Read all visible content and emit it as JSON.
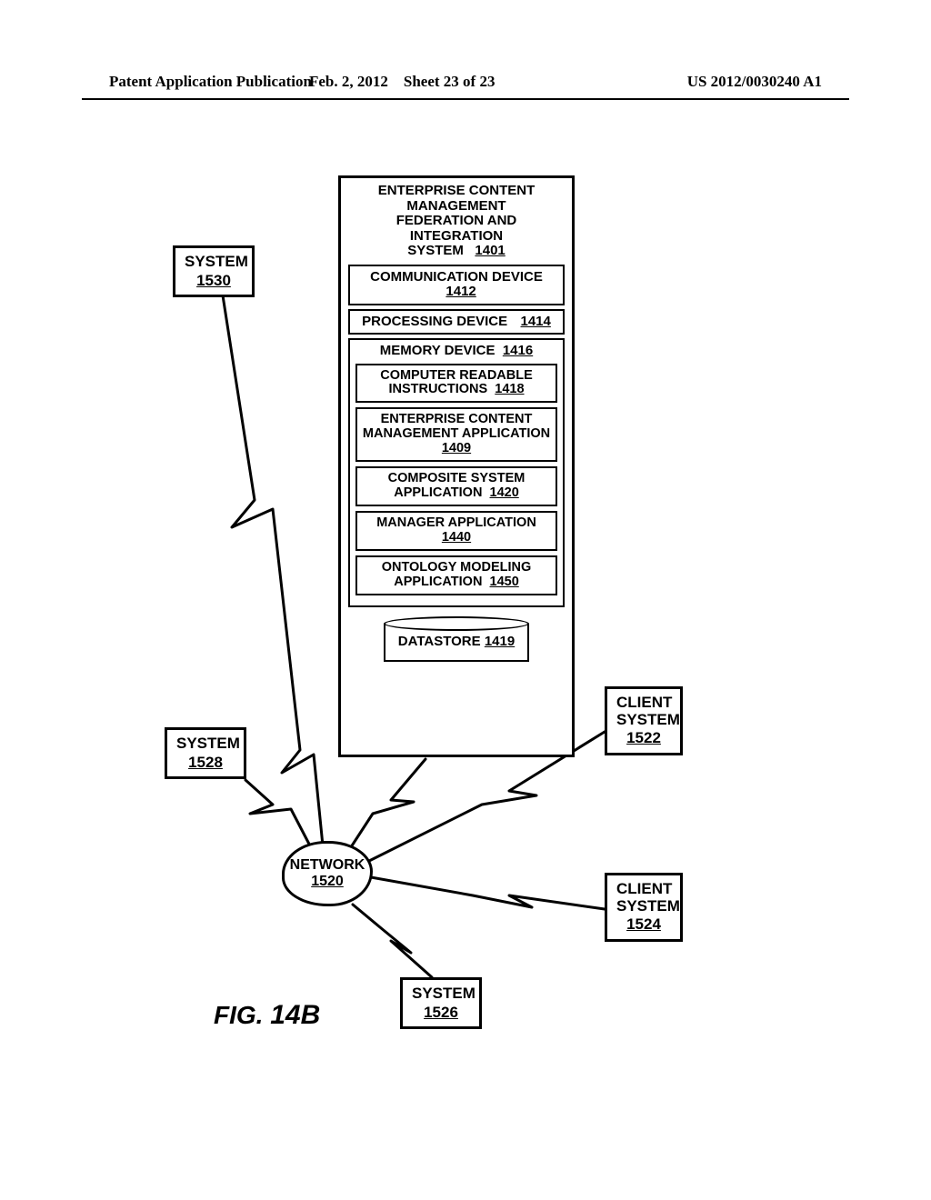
{
  "header": {
    "left": "Patent Application Publication",
    "mid_date": "Feb. 2, 2012",
    "mid_sheet": "Sheet 23 of 23",
    "right": "US 2012/0030240 A1"
  },
  "ecm": {
    "title_l1": "ENTERPRISE CONTENT MANAGEMENT",
    "title_l2": "FEDERATION AND INTEGRATION",
    "title_l3": "SYSTEM",
    "ref": "1401",
    "comm": {
      "label": "COMMUNICATION DEVICE",
      "ref": "1412"
    },
    "proc": {
      "label": "PROCESSING DEVICE",
      "ref": "1414"
    },
    "mem": {
      "label": "MEMORY DEVICE",
      "ref": "1416"
    },
    "cri": {
      "label_l1": "COMPUTER READABLE",
      "label_l2": "INSTRUCTIONS",
      "ref": "1418"
    },
    "app": {
      "label_l1": "ENTERPRISE CONTENT",
      "label_l2": "MANAGEMENT APPLICATION",
      "ref": "1409"
    },
    "comp": {
      "label_l1": "COMPOSITE SYSTEM",
      "label_l2": "APPLICATION",
      "ref": "1420"
    },
    "mgr": {
      "label_l1": "MANAGER APPLICATION",
      "ref": "1440"
    },
    "ont": {
      "label_l1": "ONTOLOGY MODELING",
      "label_l2": "APPLICATION",
      "ref": "1450"
    },
    "ds": {
      "label": "DATASTORE",
      "ref": "1419"
    }
  },
  "nodes": {
    "sys1530": {
      "label": "SYSTEM",
      "ref": "1530"
    },
    "sys1528": {
      "label": "SYSTEM",
      "ref": "1528"
    },
    "sys1526": {
      "label": "SYSTEM",
      "ref": "1526"
    },
    "client1522": {
      "label_l1": "CLIENT",
      "label_l2": "SYSTEM",
      "ref": "1522"
    },
    "client1524": {
      "label_l1": "CLIENT",
      "label_l2": "SYSTEM",
      "ref": "1524"
    },
    "network": {
      "label": "NETWORK",
      "ref": "1520"
    }
  },
  "figure": {
    "prefix": "FIG.",
    "num": "14B"
  }
}
